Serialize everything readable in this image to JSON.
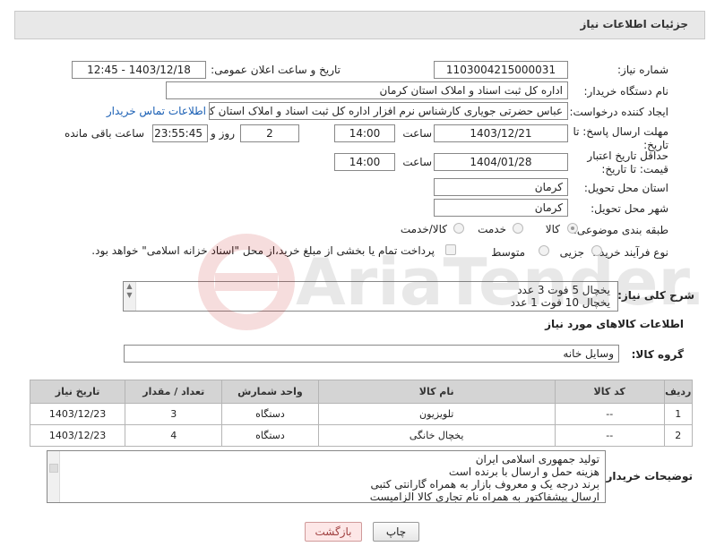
{
  "header": {
    "title": "جزئیات اطلاعات نیاز"
  },
  "fields": {
    "need_number_label": "شماره نیاز:",
    "need_number": "1103004215000031",
    "announce_label": "تاریخ و ساعت اعلان عمومی:",
    "announce_value": "1403/12/18 - 12:45",
    "buyer_org_label": "نام دستگاه خریدار:",
    "buyer_org": "اداره کل ثبت اسناد و املاک استان کرمان",
    "creator_label": "ایجاد کننده درخواست:",
    "creator": "عباس حضرتی جویاری کارشناس نرم افزار اداره کل ثبت اسناد و املاک استان کرمان",
    "contact_link": "اطلاعات تماس خریدار",
    "deadline_label": "مهلت ارسال پاسخ: تا تاریخ:",
    "deadline_date": "1403/12/21",
    "time_label": "ساعت",
    "deadline_time": "14:00",
    "days_value": "2",
    "days_label": "روز و",
    "remaining_value": "23:55:45",
    "remaining_label": "ساعت باقی مانده",
    "min_validity_label": "حداقل تاریخ اعتبار قیمت: تا تاریخ:",
    "validity_date": "1404/01/28",
    "validity_time": "14:00",
    "province_label": "استان محل تحویل:",
    "province": "کرمان",
    "city_label": "شهر محل تحویل:",
    "city": "کرمان",
    "category_label": "طبقه بندی موضوعی:",
    "category_options": [
      "کالا",
      "خدمت",
      "کالا/خدمت"
    ],
    "process_label": "نوع فرآیند خرید :",
    "process_options": [
      "جزیی",
      "متوسط"
    ],
    "payment_note": "پرداخت تمام یا بخشی از مبلغ خرید،از محل \"اسناد خزانه اسلامی\" خواهد بود."
  },
  "description": {
    "label": "شرح کلی نیاز:",
    "lines": [
      "یخچال 5 فوت 3 عدد",
      "یخچال 10 فوت 1 عدد"
    ]
  },
  "goods_section": {
    "title": "اطلاعات کالاهای مورد نیاز",
    "group_label": "گروه کالا:",
    "group_value": "وسایل خانه"
  },
  "table": {
    "headers": [
      "ردیف",
      "کد کالا",
      "نام کالا",
      "واحد شمارش",
      "تعداد / مقدار",
      "تاریخ نیاز"
    ],
    "rows": [
      [
        "1",
        "--",
        "تلویزیون",
        "دستگاه",
        "3",
        "1403/12/23"
      ],
      [
        "2",
        "--",
        "یخچال خانگی",
        "دستگاه",
        "4",
        "1403/12/23"
      ]
    ]
  },
  "buyer_notes": {
    "label": "توضیحات خریدار:",
    "lines": [
      "تولید جمهوری اسلامی ایران",
      "هزینه حمل و ارسال با برنده است",
      "برند درجه یک و معروف بازار به همراه گارانتی کتبی",
      "ارسال پیشفاکتور به همراه نام تجاری کالا الزامیست"
    ]
  },
  "buttons": {
    "print": "چاپ",
    "back": "بازگشت"
  },
  "watermark": {
    "text": "AriaTender.neT"
  },
  "colors": {
    "link": "#1a5fb4",
    "header_bg": "#e8e8e8",
    "table_header_bg": "#d4d4d4",
    "back_button_bg": "#fde7e7"
  }
}
